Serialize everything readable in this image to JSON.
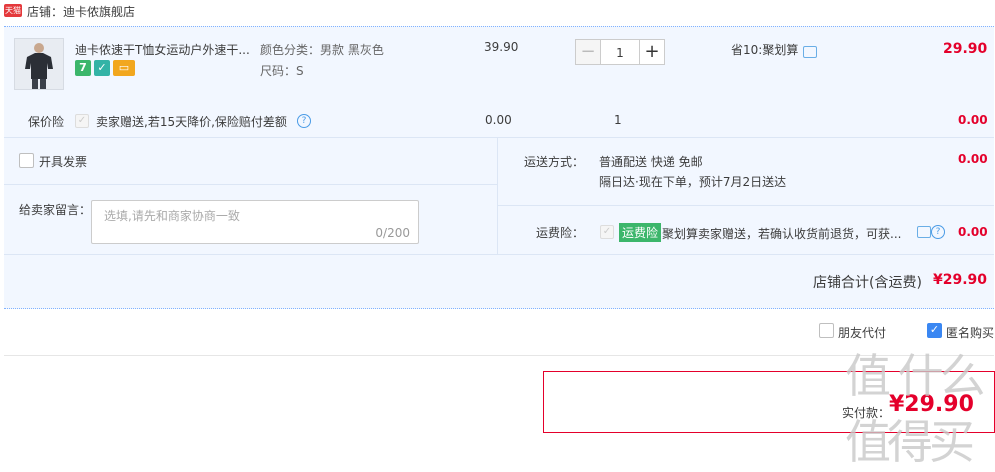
{
  "shop": {
    "badge": "天猫",
    "name": "店铺：迪卡侬旗舰店"
  },
  "item": {
    "title": "迪卡侬速干T恤女运动户外速干...",
    "color_label": "颜色分类：男款 黑灰色",
    "size_label": "尺码：S",
    "unit_price": "39.90",
    "quantity": "1",
    "promo": "省10:聚划算",
    "subtotal": "29.90",
    "service_icons": [
      "seven-day-return-icon",
      "guarantee-icon",
      "credit-card-icon"
    ],
    "service_icon_text": "7"
  },
  "insurance": {
    "label": "保价险",
    "desc": "卖家赠送,若15天降价,保险赔付差额",
    "price": "0.00",
    "qty": "1",
    "subtotal": "0.00"
  },
  "invoice": {
    "label": "开具发票"
  },
  "message": {
    "label": "给卖家留言：",
    "placeholder": "选填,请先和商家协商一致",
    "counter": "0/200"
  },
  "shipping": {
    "label": "运送方式：",
    "method": "普通配送 快递 免邮",
    "eta": "隔日达·现在下单，预计7月2日送达",
    "fee": "0.00"
  },
  "freight_insurance": {
    "label": "运费险：",
    "tag": "运费险",
    "desc": "聚划算卖家赠送，若确认收货前退货，可获...",
    "fee": "0.00"
  },
  "total": {
    "label": "店铺合计(含运费)",
    "amount": "¥29.90"
  },
  "options": {
    "friend_pay": "朋友代付",
    "anonymous": "匿名购买"
  },
  "pay": {
    "label": "实付款：",
    "amount": "¥29.90"
  },
  "watermark": "值 什么值得买",
  "colors": {
    "price_red": "#e4002b",
    "accent_blue": "#3a87f2",
    "panel_bg": "#f2f7ff"
  }
}
